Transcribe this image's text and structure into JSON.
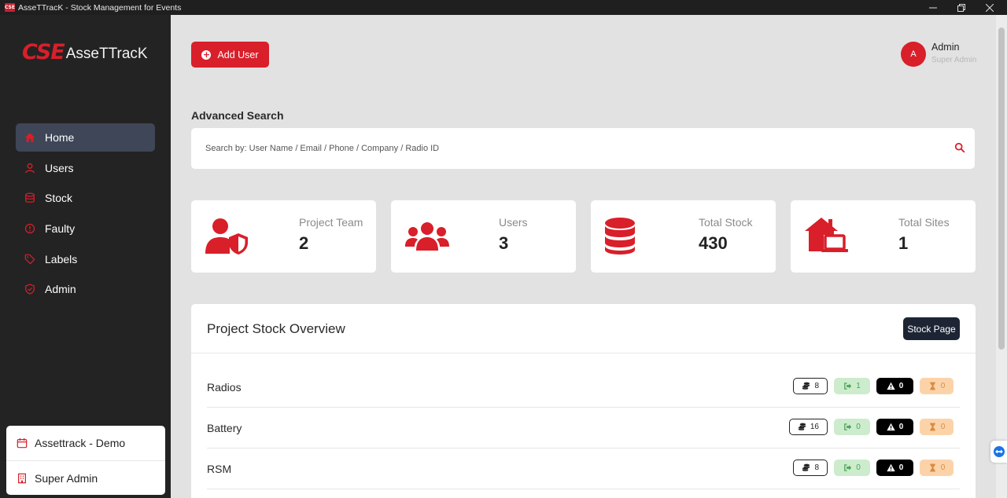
{
  "window": {
    "title": "AsseTTracK - Stock Management for Events",
    "app_icon": "CSE"
  },
  "sidebar": {
    "logo": {
      "cse": "CSE",
      "brand": "AsseTTracK"
    },
    "items": [
      {
        "label": "Home",
        "icon": "home-icon",
        "active": true
      },
      {
        "label": "Users",
        "icon": "user-icon"
      },
      {
        "label": "Stock",
        "icon": "database-icon"
      },
      {
        "label": "Faulty",
        "icon": "alert-circle-icon"
      },
      {
        "label": "Labels",
        "icon": "tag-icon"
      },
      {
        "label": "Admin",
        "icon": "shield-icon"
      }
    ],
    "bottom": {
      "project": "Assettrack - Demo",
      "role": "Super Admin"
    }
  },
  "header": {
    "add_user_label": "Add User",
    "user": {
      "initial": "A",
      "name": "Admin",
      "role": "Super Admin"
    }
  },
  "search": {
    "title": "Advanced Search",
    "placeholder": "Search by: User Name / Email / Phone / Company / Radio ID"
  },
  "stats": [
    {
      "label": "Project Team",
      "value": "2",
      "icon": "user-shield-icon"
    },
    {
      "label": "Users",
      "value": "3",
      "icon": "users-icon"
    },
    {
      "label": "Total Stock",
      "value": "430",
      "icon": "database-icon"
    },
    {
      "label": "Total Sites",
      "value": "1",
      "icon": "house-laptop-icon"
    }
  ],
  "overview": {
    "title": "Project Stock Overview",
    "stock_page_label": "Stock Page",
    "rows": [
      {
        "name": "Radios",
        "stock": "8",
        "out": "1",
        "faulty": "0",
        "pending": "0"
      },
      {
        "name": "Battery",
        "stock": "16",
        "out": "0",
        "faulty": "0",
        "pending": "0"
      },
      {
        "name": "RSM",
        "stock": "8",
        "out": "0",
        "faulty": "0",
        "pending": "0"
      }
    ]
  },
  "colors": {
    "brand_red": "#d81f2a",
    "sidebar_bg": "#232323",
    "active_nav": "#3e4657",
    "dark_button": "#1d2535"
  }
}
